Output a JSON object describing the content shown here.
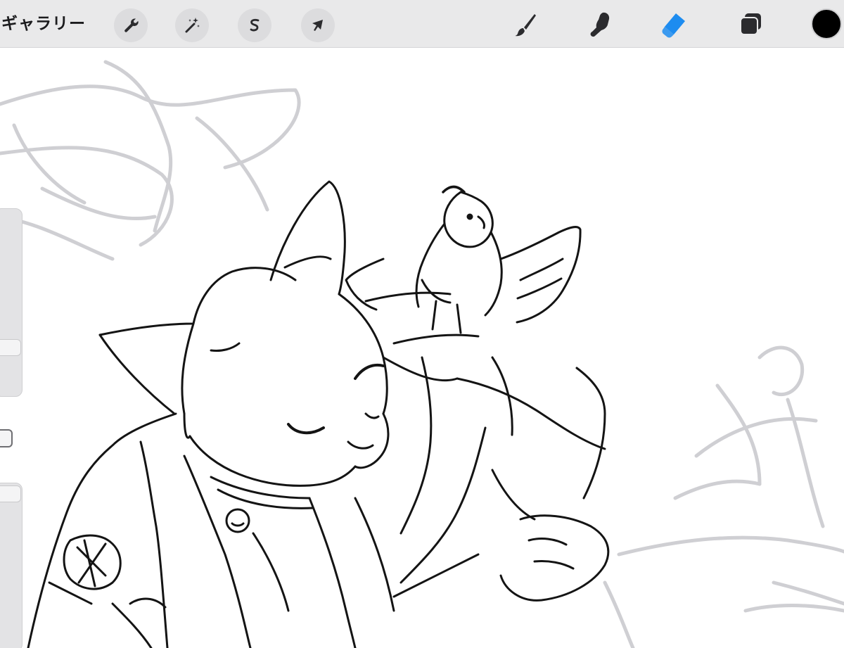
{
  "toolbar": {
    "gallery_label": "ギャラリー",
    "actions_icon": "wrench-icon",
    "adjustments_icon": "magic-wand-icon",
    "selection_icon": "selection-s-icon",
    "transform_icon": "arrow-cursor-icon",
    "brush_icon": "brush-icon",
    "smudge_icon": "smudge-finger-icon",
    "eraser_icon": "eraser-icon",
    "layers_icon": "layers-icon",
    "active_tool": "eraser",
    "active_color": "#000000",
    "accent_color": "#1d8cf0"
  },
  "sidebar": {
    "brush_size_icon": "size-slider",
    "modify_icon": "square-modify-icon",
    "opacity_icon": "opacity-slider"
  }
}
